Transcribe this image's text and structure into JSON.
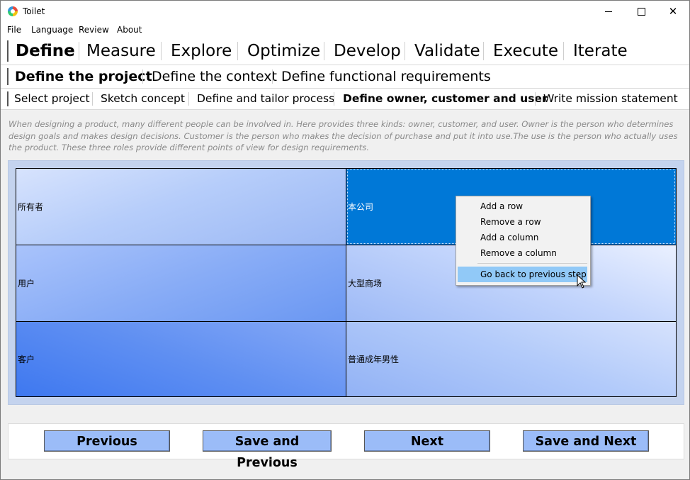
{
  "window": {
    "title": "Toilet",
    "controls": {
      "minimize": "—",
      "maximize": "☐",
      "close": "✕"
    }
  },
  "menu": [
    "File",
    "Language",
    "Review",
    "About"
  ],
  "phase_tabs": [
    {
      "label": "Define",
      "active": true
    },
    {
      "label": "Measure",
      "active": false
    },
    {
      "label": "Explore",
      "active": false
    },
    {
      "label": "Optimize",
      "active": false
    },
    {
      "label": "Develop",
      "active": false
    },
    {
      "label": "Validate",
      "active": false
    },
    {
      "label": "Execute",
      "active": false
    },
    {
      "label": "Iterate",
      "active": false
    }
  ],
  "sub_tabs": [
    {
      "label": "Define the project",
      "active": true
    },
    {
      "label": "Define the context",
      "active": false
    },
    {
      "label": "Define functional requirements",
      "active": false
    }
  ],
  "step_tabs": [
    {
      "label": "Select project",
      "active": false
    },
    {
      "label": "Sketch concept",
      "active": false
    },
    {
      "label": "Define and tailor process",
      "active": false
    },
    {
      "label": "Define owner, customer and user",
      "active": true
    },
    {
      "label": "Write mission statement",
      "active": false
    }
  ],
  "description": "When designing a product, many different people can be involved in. Here provides three kinds: owner, customer, and user. Owner is the person who determines design goals and makes design decisions. Customer is the person who makes the decision of purchase and put it into use.The use is the person who actually uses the product. These three roles provide different points of view for design requirements.",
  "table": {
    "rows": [
      {
        "role": "所有者",
        "value": "本公司",
        "selected": true
      },
      {
        "role": "用户",
        "value": "大型商场",
        "selected": false
      },
      {
        "role": "客户",
        "value": "普通成年男性",
        "selected": false
      }
    ]
  },
  "context_menu": {
    "items": [
      "Add a row",
      "Remove a row",
      "Add a column",
      "Remove a column"
    ],
    "highlighted": "Go back to previous step"
  },
  "buttons": {
    "previous": "Previous",
    "save_previous": "Save and Previous",
    "next": "Next",
    "save_next": "Save and Next"
  },
  "colors": {
    "selected_cell": "#0078d7",
    "button_bg": "#9bbcf8",
    "menu_highlight": "#91c9f7"
  }
}
